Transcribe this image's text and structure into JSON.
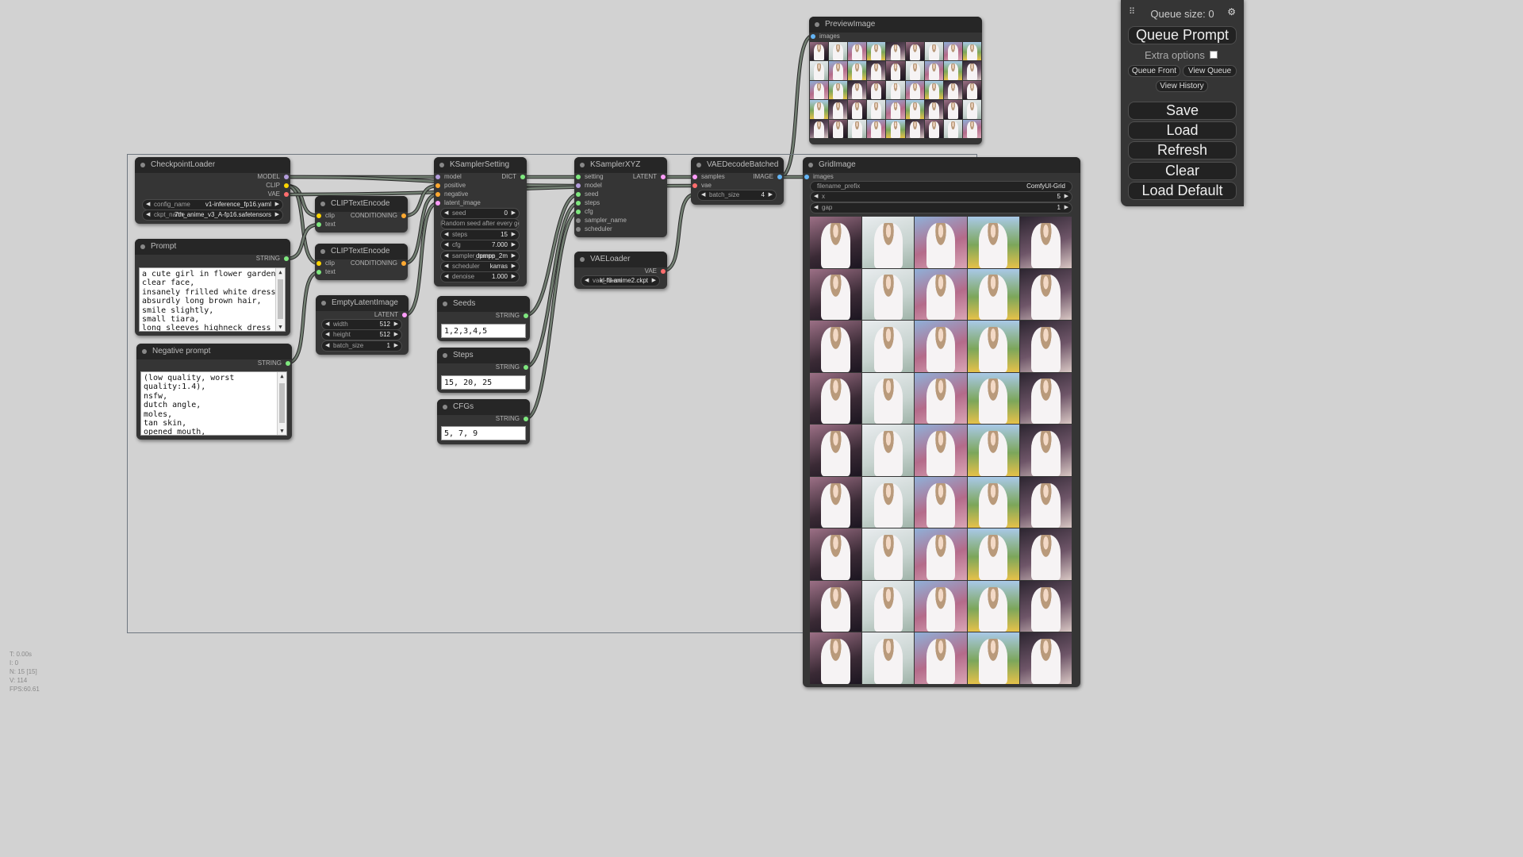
{
  "menu": {
    "queue_size": "Queue size: 0",
    "queue_prompt": "Queue Prompt",
    "extra_options": "Extra options",
    "queue_front": "Queue Front",
    "view_queue": "View Queue",
    "view_history": "View History",
    "save": "Save",
    "load": "Load",
    "refresh": "Refresh",
    "clear": "Clear",
    "load_default": "Load Default"
  },
  "stats": [
    "T: 0.00s",
    "I: 0",
    "N: 15 [15]",
    "V: 114",
    "FPS:60.61"
  ],
  "nodes": {
    "checkpoint_loader": {
      "title": "CheckpointLoader",
      "outputs": [
        "MODEL",
        "CLIP",
        "VAE"
      ],
      "config_name_label": "config_name",
      "config_name_value": "v1-inference_fp16.yaml",
      "ckpt_name_label": "ckpt_name",
      "ckpt_name_value": "7th_anime_v3_A-fp16.safetensors"
    },
    "prompt": {
      "title": "Prompt",
      "output": "STRING",
      "text": "a cute girl in flower garden,\nclear face,\ninsanely frilled white dress,\nabsurdly long brown hair,\nsmile slightly,\nsmall tiara,\nlong sleeves highneck dress"
    },
    "negative_prompt": {
      "title": "Negative prompt",
      "output": "STRING",
      "text": "(low quality, worst\nquality:1.4),\nnsfw,\ndutch angle,\nmoles,\ntan skin,\nopened mouth,"
    },
    "clip_text_encode_1": {
      "title": "CLIPTextEncode",
      "inputs": [
        "clip",
        "text"
      ],
      "output": "CONDITIONING"
    },
    "clip_text_encode_2": {
      "title": "CLIPTextEncode",
      "inputs": [
        "clip",
        "text"
      ],
      "output": "CONDITIONING"
    },
    "empty_latent": {
      "title": "EmptyLatentImage",
      "output": "LATENT",
      "width_label": "width",
      "width_value": "512",
      "height_label": "height",
      "height_value": "512",
      "batch_label": "batch_size",
      "batch_value": "1"
    },
    "ksampler_setting": {
      "title": "KSamplerSetting",
      "inputs": [
        "model",
        "positive",
        "negative",
        "latent_image"
      ],
      "output": "DICT",
      "seed_label": "seed",
      "seed_value": "0",
      "control_text": "Random seed after every gen",
      "steps_label": "steps",
      "steps_value": "15",
      "cfg_label": "cfg",
      "cfg_value": "7.000",
      "sampler_label": "sampler_name",
      "sampler_value": "dpmpp_2m",
      "scheduler_label": "scheduler",
      "scheduler_value": "karras",
      "denoise_label": "denoise",
      "denoise_value": "1.000"
    },
    "seeds": {
      "title": "Seeds",
      "output": "STRING",
      "value": "1,2,3,4,5"
    },
    "steps": {
      "title": "Steps",
      "output": "STRING",
      "value": "15, 20, 25"
    },
    "cfgs": {
      "title": "CFGs",
      "output": "STRING",
      "value": "5, 7, 9"
    },
    "ksampler_xyz": {
      "title": "KSamplerXYZ",
      "inputs": [
        "setting",
        "model",
        "seed",
        "steps",
        "cfg",
        "sampler_name",
        "scheduler"
      ],
      "output": "LATENT"
    },
    "vae_loader": {
      "title": "VAELoader",
      "output": "VAE",
      "vae_label": "vae_name",
      "vae_value": "kl-f8-anime2.ckpt"
    },
    "vae_decode_batched": {
      "title": "VAEDecodeBatched",
      "inputs": [
        "samples",
        "vae"
      ],
      "output": "IMAGE",
      "batch_label": "batch_size",
      "batch_value": "4"
    },
    "preview_image": {
      "title": "PreviewImage",
      "input": "images"
    },
    "grid_image": {
      "title": "GridImage",
      "input": "images",
      "prefix_label": "filename_prefix",
      "prefix_value": "ComfyUI-Grid",
      "x_label": "x",
      "x_value": "5",
      "gap_label": "gap",
      "gap_value": "1"
    }
  },
  "colors": {
    "model": "#b39ddb",
    "clip": "#ffd500",
    "vae": "#ff6e6e",
    "conditioning": "#ffa931",
    "latent": "#ff9cf9",
    "string": "#7fe87f",
    "image": "#64b5f6",
    "dict": "#7fe87f"
  }
}
